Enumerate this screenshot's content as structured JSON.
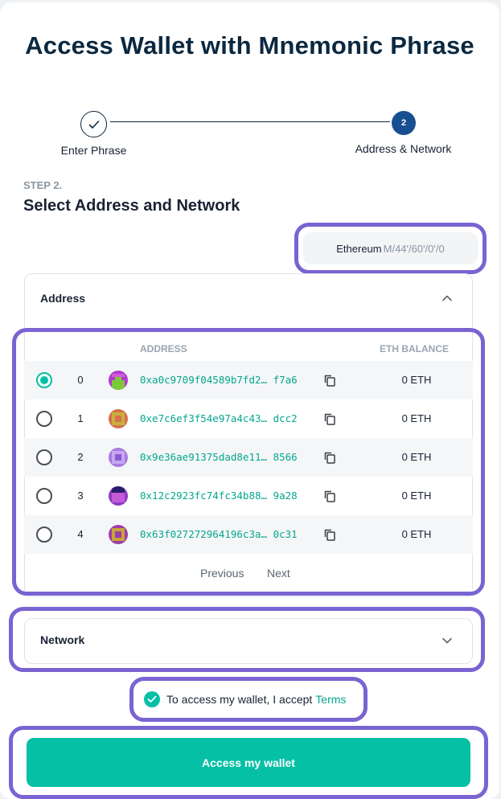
{
  "page": {
    "title": "Access Wallet with Mnemonic Phrase"
  },
  "stepper": {
    "step1_label": "Enter Phrase",
    "step2_number": "2",
    "step2_label": "Address & Network"
  },
  "section": {
    "kicker": "STEP 2.",
    "heading": "Select Address and Network"
  },
  "network_chip": {
    "name": "Ethereum",
    "path": "M/44'/60'/0'/0"
  },
  "address_panel": {
    "header": "Address",
    "columns": {
      "address": "ADDRESS",
      "balance": "ETH BALANCE"
    },
    "rows": [
      {
        "index": "0",
        "address": "0xa0c9709f04589b7fd2… f7a6",
        "balance": "0 ETH",
        "selected": true
      },
      {
        "index": "1",
        "address": "0xe7c6ef3f54e97a4c43… dcc2",
        "balance": "0 ETH",
        "selected": false
      },
      {
        "index": "2",
        "address": "0x9e36ae91375dad8e11… 8566",
        "balance": "0 ETH",
        "selected": false
      },
      {
        "index": "3",
        "address": "0x12c2923fc74fc34b88… 9a28",
        "balance": "0 ETH",
        "selected": false
      },
      {
        "index": "4",
        "address": "0x63f027272964196c3a… 0c31",
        "balance": "0 ETH",
        "selected": false
      }
    ],
    "previous_label": "Previous",
    "next_label": "Next"
  },
  "network_panel": {
    "header": "Network"
  },
  "terms": {
    "text": "To access my wallet, I accept",
    "link": "Terms"
  },
  "cta": {
    "label": "Access my wallet"
  },
  "colors": {
    "accent": "#05c0a5",
    "step_active": "#184f90",
    "highlight": "#7a63d2",
    "title": "#0b2840"
  },
  "icons": {
    "step_done": "checkmark-icon",
    "copy": "copy-icon",
    "collapse": "chevron-up-icon",
    "expand": "chevron-down-icon",
    "terms_check": "check-circle-icon"
  }
}
